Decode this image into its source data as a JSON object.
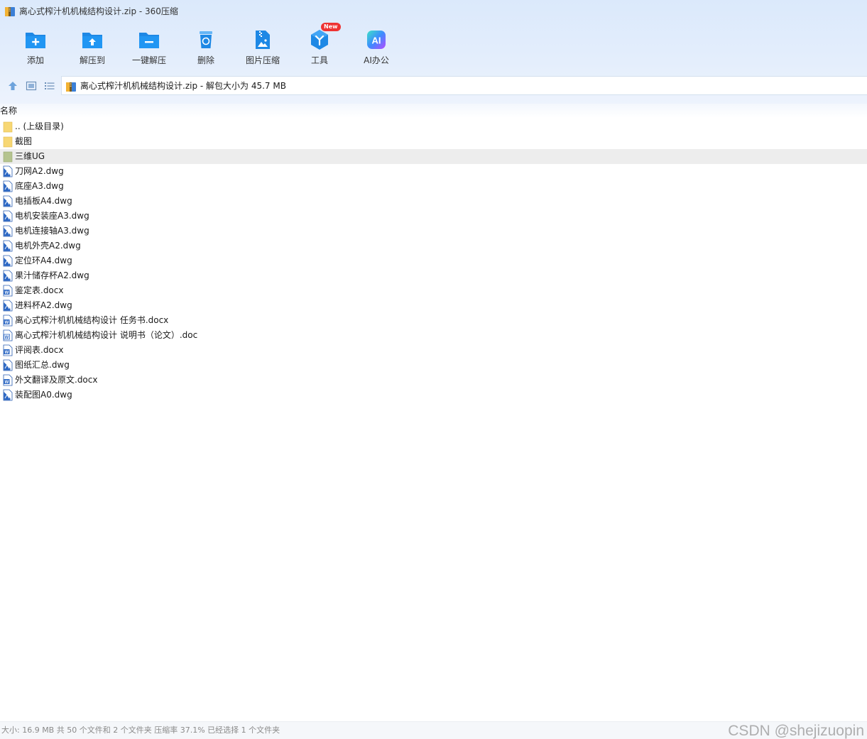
{
  "window": {
    "title": "离心式榨汁机机械结构设计.zip - 360压缩"
  },
  "toolbar": {
    "items": [
      {
        "label": "添加",
        "icon": "add-folder-icon"
      },
      {
        "label": "解压到",
        "icon": "extract-to-icon"
      },
      {
        "label": "一键解压",
        "icon": "one-click-extract-icon"
      },
      {
        "label": "删除",
        "icon": "delete-icon"
      },
      {
        "label": "图片压缩",
        "icon": "image-compress-icon"
      },
      {
        "label": "工具",
        "icon": "tools-icon",
        "badge": "New"
      },
      {
        "label": "AI办公",
        "icon": "ai-office-icon"
      }
    ]
  },
  "address": {
    "path": "离心式榨汁机机械结构设计.zip - 解包大小为 45.7 MB"
  },
  "list": {
    "column_name": "名称",
    "rows": [
      {
        "name": ".. (上级目录)",
        "type": "folder"
      },
      {
        "name": "截图",
        "type": "folder"
      },
      {
        "name": "三维UG",
        "type": "folder-dark"
      },
      {
        "name": "刀网A2.dwg",
        "type": "dwg"
      },
      {
        "name": "底座A3.dwg",
        "type": "dwg"
      },
      {
        "name": "电插板A4.dwg",
        "type": "dwg"
      },
      {
        "name": "电机安装座A3.dwg",
        "type": "dwg"
      },
      {
        "name": "电机连接轴A3.dwg",
        "type": "dwg"
      },
      {
        "name": "电机外壳A2.dwg",
        "type": "dwg"
      },
      {
        "name": "定位环A4.dwg",
        "type": "dwg"
      },
      {
        "name": "果汁储存杯A2.dwg",
        "type": "dwg"
      },
      {
        "name": "鉴定表.docx",
        "type": "docx"
      },
      {
        "name": "进料杯A2.dwg",
        "type": "dwg"
      },
      {
        "name": "离心式榨汁机机械结构设计 任务书.docx",
        "type": "docx"
      },
      {
        "name": "离心式榨汁机机械结构设计 说明书（论文）.doc",
        "type": "doc"
      },
      {
        "name": "评阅表.docx",
        "type": "docx"
      },
      {
        "name": "图纸汇总.dwg",
        "type": "dwg"
      },
      {
        "name": "外文翻译及原文.docx",
        "type": "docx"
      },
      {
        "name": "装配图A0.dwg",
        "type": "dwg"
      }
    ]
  },
  "status": {
    "text": "大小: 16.9 MB 共 50 个文件和 2 个文件夹 压缩率 37.1% 已经选择 1 个文件夹"
  },
  "watermark": "CSDN @shejizuopin",
  "colors": {
    "toolbar_blue": "#1e88e5",
    "folder_yellow": "#f7d774",
    "folder_selected": "#b5c48f",
    "row_highlight": "#ededed"
  }
}
